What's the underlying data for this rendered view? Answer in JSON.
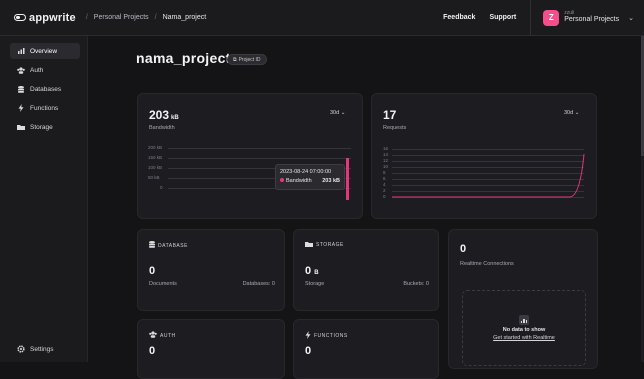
{
  "topbar": {
    "logo": "appwrite",
    "breadcrumb": [
      "Personal Projects",
      "Nama_project"
    ],
    "feedback": "Feedback",
    "support": "Support",
    "avatar_letter": "Z",
    "user_name": "zzuli",
    "org_name": "Personal Projects"
  },
  "sidebar": {
    "items": [
      {
        "label": "Overview",
        "icon": "chart-icon",
        "active": true
      },
      {
        "label": "Auth",
        "icon": "users-icon"
      },
      {
        "label": "Databases",
        "icon": "database-icon"
      },
      {
        "label": "Functions",
        "icon": "lightning-icon"
      },
      {
        "label": "Storage",
        "icon": "folder-icon"
      }
    ],
    "settings": "Settings"
  },
  "project": {
    "title": "nama_project",
    "id_badge": "Project ID"
  },
  "bandwidth": {
    "value": "203",
    "unit": "kB",
    "label": "Bandwidth",
    "period": "30d",
    "y_ticks": [
      "200 kB",
      "150 kB",
      "100 kB",
      "50 kB",
      "0"
    ],
    "tooltip_date": "2023-08-24 07:00:00",
    "tooltip_series": "Bandwidth",
    "tooltip_value": "203 kB"
  },
  "requests": {
    "value": "17",
    "label": "Requests",
    "period": "30d",
    "y_ticks": [
      "16",
      "14",
      "12",
      "10",
      "8",
      "6",
      "4",
      "2",
      "0"
    ]
  },
  "database": {
    "header": "DATABASE",
    "value": "0",
    "label": "Documents",
    "right": "Databases: 0"
  },
  "storage": {
    "header": "STORAGE",
    "value": "0",
    "unit": "B",
    "label": "Storage",
    "right": "Buckets: 0"
  },
  "realtime": {
    "value": "0",
    "label": "Realtime Connections",
    "empty_title": "No data to show",
    "empty_link": "Get started with Realtime"
  },
  "auth": {
    "header": "AUTH",
    "value": "0"
  },
  "functions": {
    "header": "FUNCTIONS",
    "value": "0"
  },
  "colors": {
    "accent": "#e8347d",
    "avatar": "#f64d8b"
  }
}
